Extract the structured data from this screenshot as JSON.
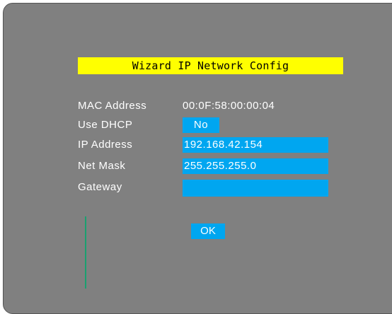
{
  "dialog": {
    "title": "Wizard IP Network Config"
  },
  "fields": {
    "mac_label": "MAC Address",
    "mac_value": "00:0F:58:00:00:04",
    "dhcp_label": "Use DHCP",
    "dhcp_value": "No",
    "ip_label": "IP Address",
    "ip_value": "192.168.42.154",
    "mask_label": "Net Mask",
    "mask_value": "255.255.255.0",
    "gateway_label": "Gateway",
    "gateway_value": ""
  },
  "actions": {
    "ok_label": "OK"
  },
  "colors": {
    "background": "#808080",
    "title_bar": "#ffff00",
    "field": "#00a6f0",
    "text": "#ffffff",
    "cursor_line": "#1aa070"
  }
}
